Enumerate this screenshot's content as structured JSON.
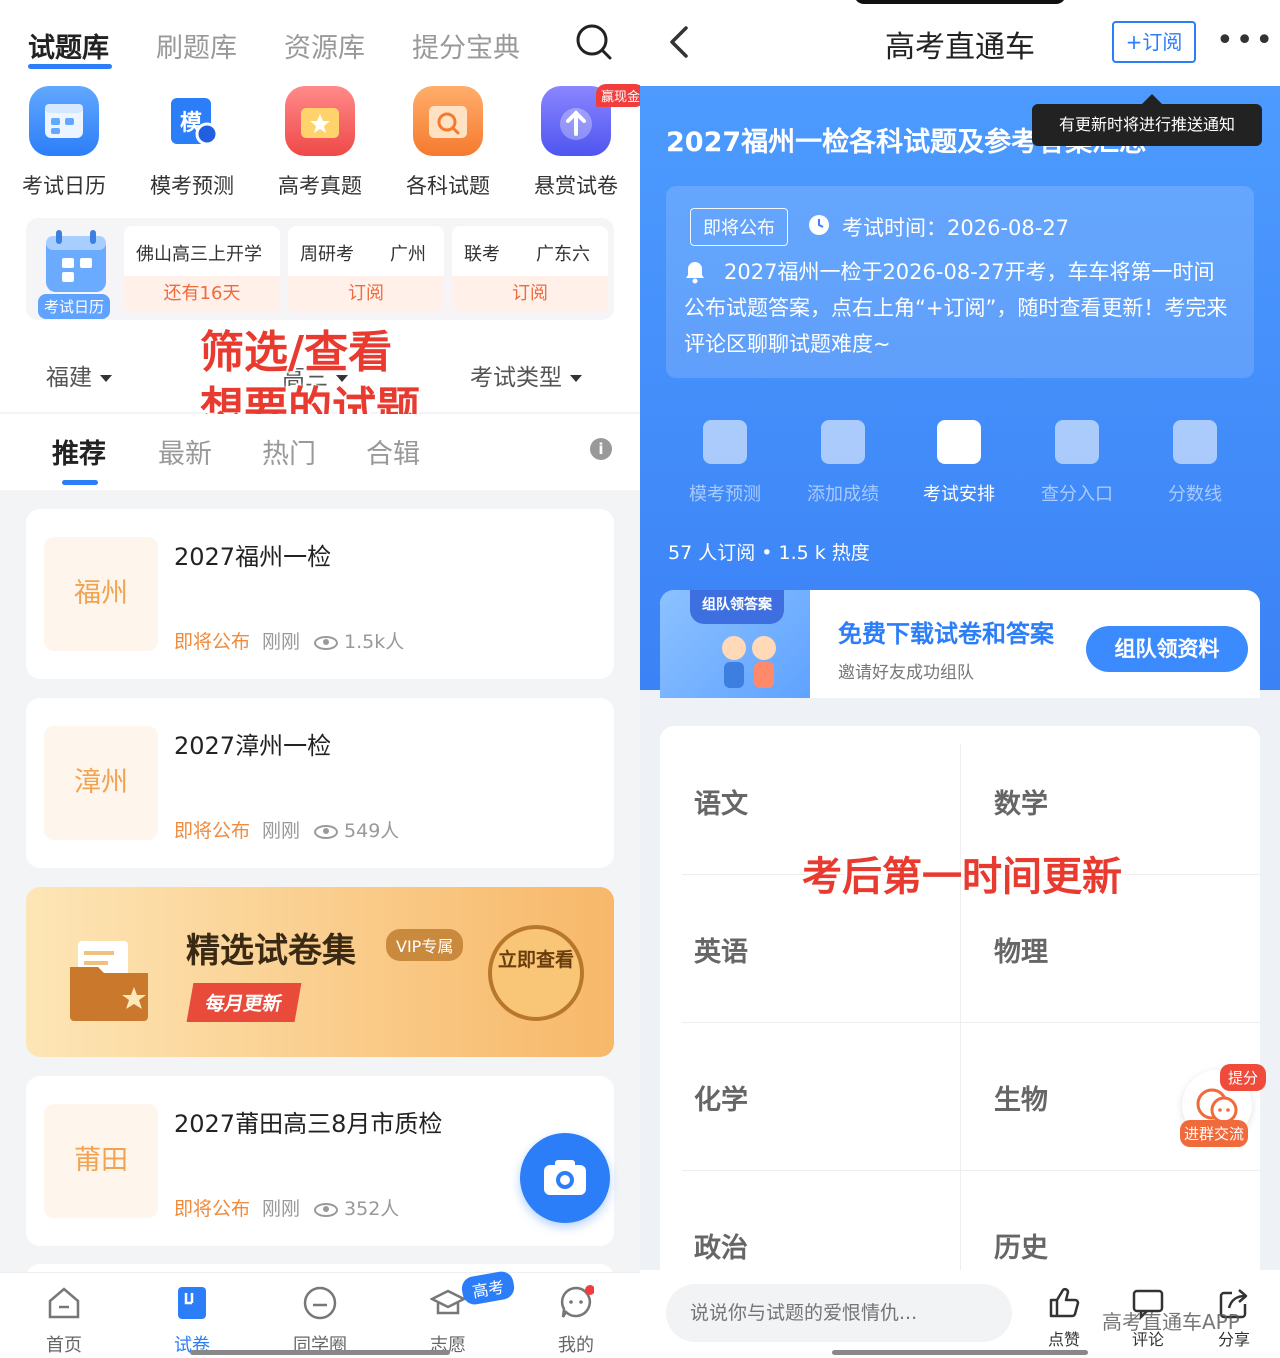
{
  "left": {
    "topnav": {
      "tabs": [
        "试题库",
        "刷题库",
        "资源库",
        "提分宝典"
      ],
      "search_icon": "search-icon"
    },
    "quick_icons": [
      {
        "label": "考试日历",
        "icon": "calendar-icon",
        "color": "#3d8bff"
      },
      {
        "label": "模考预测",
        "icon": "mock-exam-icon",
        "color": "#2c7ef8"
      },
      {
        "label": "高考真题",
        "icon": "star-folder-icon",
        "color": "#f25a5a"
      },
      {
        "label": "各科试题",
        "icon": "search-folder-icon",
        "color": "#f58a3c"
      },
      {
        "label": "悬赏试卷",
        "icon": "upload-icon",
        "color": "#6c63ff",
        "badge": "赢现金"
      }
    ],
    "calendar_strip": {
      "label": "考试日历",
      "cards": [
        {
          "title": "佛山高三上开学",
          "action": "还有16天"
        },
        {
          "title": "周研考　　广州",
          "action": "订阅"
        },
        {
          "title": "联考　　广东六",
          "action": "订阅"
        }
      ]
    },
    "filters": {
      "region": "福建",
      "grade": "高三",
      "type": "考试类型"
    },
    "overlay_text": [
      "筛选/查看",
      "想要的试题"
    ],
    "subtabs": [
      "推荐",
      "最新",
      "热门",
      "合辑"
    ],
    "exams": [
      {
        "city": "福州",
        "title": "2027福州一检",
        "status": "即将公布",
        "time": "刚刚",
        "views": "1.5k人"
      },
      {
        "city": "漳州",
        "title": "2027漳州一检",
        "status": "即将公布",
        "time": "刚刚",
        "views": "549人"
      },
      {
        "city": "莆田",
        "title": "2027莆田高三8月市质检",
        "status": "即将公布",
        "time": "刚刚",
        "views": "352人"
      }
    ],
    "promo": {
      "title": "精选试卷集",
      "vip": "VIP专属",
      "monthly": "每月更新",
      "go": "立即查看"
    },
    "bottomnav": [
      {
        "label": "首页",
        "icon": "home-icon"
      },
      {
        "label": "试卷",
        "icon": "paper-icon"
      },
      {
        "label": "同学圈",
        "icon": "chat-icon"
      },
      {
        "label": "志愿",
        "icon": "graduation-cap-icon"
      },
      {
        "label": "我的",
        "icon": "profile-icon"
      }
    ],
    "gaokao_tag": "高考"
  },
  "right": {
    "header": {
      "title": "高考直通车",
      "subscribe": "+订阅",
      "more": "•••"
    },
    "tooltip": "有更新时将进行推送通知",
    "page_title": "2027福州一检各科试题及参考答案汇总",
    "info": {
      "status": "即将公布",
      "exam_time": "考试时间：2026-08-27",
      "notice": "2027福州一检于2026-08-27开考，车车将第一时间公布试题答案，点右上角“+订阅”，随时查看更新！考完来评论区聊聊试题难度~"
    },
    "tools": [
      "模考预测",
      "添加成绩",
      "考试安排",
      "查分入口",
      "分数线"
    ],
    "stats": "57 人订阅 • 1.5 k 热度",
    "team": {
      "art_tag": "组队领答案",
      "title": "免费下载试卷和答案",
      "subtitle": "邀请好友成功组队",
      "button": "组队领资料"
    },
    "subjects": [
      "语文",
      "数学",
      "英语",
      "物理",
      "化学",
      "生物",
      "政治",
      "历史"
    ],
    "overlay_text": "考后第一时间更新",
    "group_fab": {
      "badge": "提分",
      "label": "进群交流"
    },
    "comment_placeholder": "说说你与试题的爱恨情仇...",
    "actions": [
      "点赞",
      "评论",
      "分享"
    ],
    "watermark": "高考直通车APP"
  }
}
